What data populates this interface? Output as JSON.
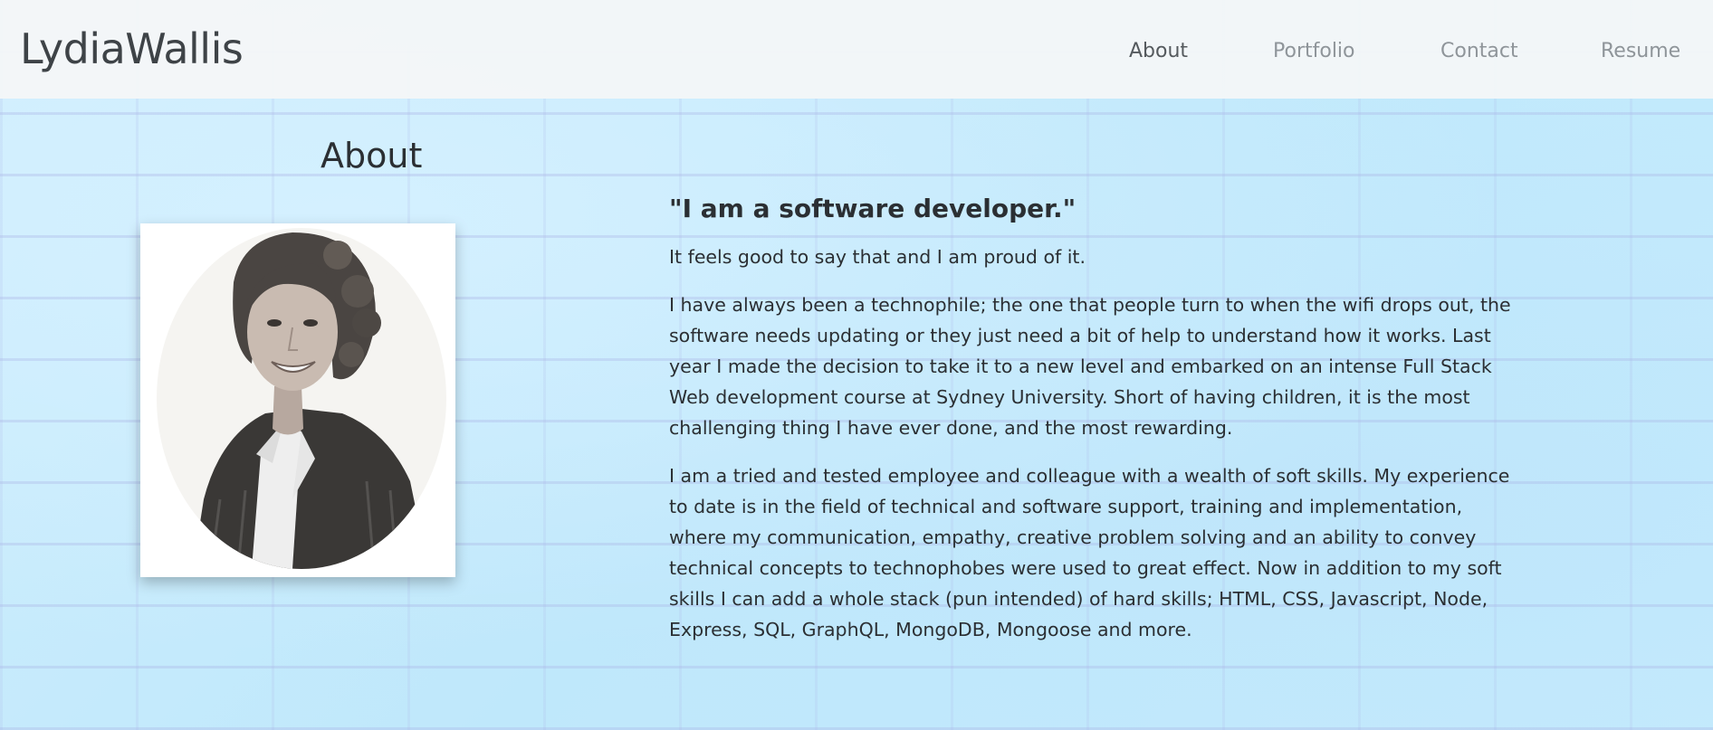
{
  "navbar": {
    "brand": "LydiaWallis",
    "links": [
      {
        "label": "About",
        "active": true
      },
      {
        "label": "Portfolio",
        "active": false
      },
      {
        "label": "Contact",
        "active": false
      },
      {
        "label": "Resume",
        "active": false
      }
    ]
  },
  "about": {
    "title": "About",
    "quote": "\"I am a software developer.\"",
    "paragraphs": [
      "It feels good to say that and I am proud of it.",
      "I have always been a technophile; the one that people turn to when the wifi drops out, the software needs updating or they just need a bit of help to understand how it works. Last year I made the decision to take it to a new level and embarked on an intense Full Stack Web development course at Sydney University. Short of having children, it is the most challenging thing I have ever done, and the most rewarding.",
      "I am a tried and tested employee and colleague with a wealth of soft skills. My experience to date is in the field of technical and software support, training and implementation, where my communication, empathy, creative problem solving and an ability to convey technical concepts to technophobes were used to great effect. Now in addition to my soft skills I can add a whole stack (pun intended) of hard skills; HTML, CSS, Javascript, Node, Express, SQL, GraphQL, MongoDB, Mongoose and more."
    ]
  },
  "colors": {
    "background": "#c8ecfc",
    "navbar": "#f4f7f8",
    "text": "#2b2f33",
    "nav_inactive": "#8f959a",
    "nav_active": "#555a5e"
  }
}
